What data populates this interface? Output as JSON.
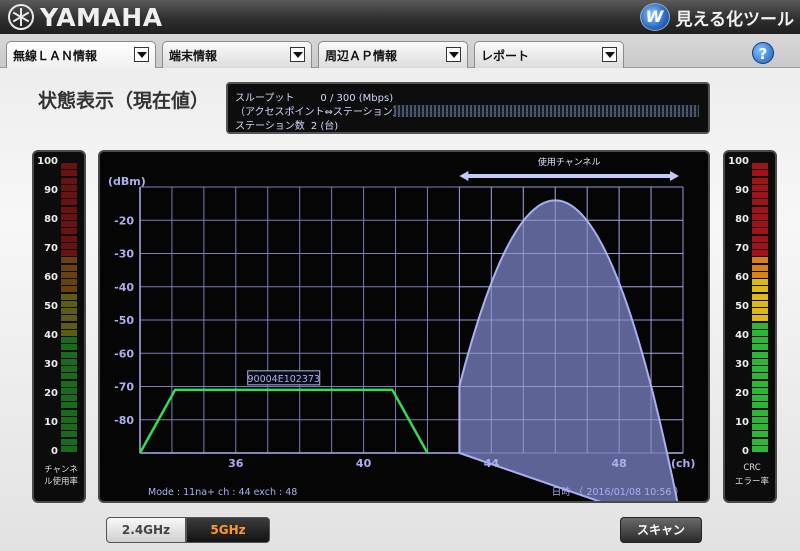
{
  "header": {
    "logo_text": "YAMAHA",
    "app_title": "見える化ツール",
    "app_icon": "W"
  },
  "tabs": [
    {
      "label": "無線ＬＡＮ情報",
      "active": true
    },
    {
      "label": "端末情報",
      "active": false
    },
    {
      "label": "周辺ＡＰ情報",
      "active": false
    },
    {
      "label": "レポート",
      "active": false
    }
  ],
  "help": {
    "label": "?"
  },
  "page_title": "状態表示（現在値）",
  "stats": {
    "throughput_label": "スループット",
    "throughput_value": "0 / 300 (Mbps)",
    "throughput_sub": "（アクセスポイント⇔ステーション）",
    "stations_label": "ステーション数",
    "stations_value": "2 (台)",
    "throughput_fraction": 0
  },
  "left_meter": {
    "ticks": [
      "100",
      "90",
      "80",
      "70",
      "60",
      "50",
      "40",
      "30",
      "20",
      "10",
      "0"
    ],
    "caption": [
      "チャンネ",
      "ル使用率"
    ],
    "level": 0
  },
  "right_meter": {
    "ticks": [
      "100",
      "90",
      "80",
      "70",
      "60",
      "50",
      "40",
      "30",
      "20",
      "10",
      "0"
    ],
    "caption": [
      "CRC",
      "エラー率"
    ],
    "level": 0
  },
  "chart_data": {
    "type": "area",
    "ylabel": "(dBm)",
    "xlabel": "(ch)",
    "ylim": [
      -90,
      -10
    ],
    "xlim": [
      33,
      50
    ],
    "y_ticks": [
      -20,
      -30,
      -40,
      -50,
      -60,
      -70,
      -80
    ],
    "x_ticks": [
      36,
      40,
      44,
      48
    ],
    "grid": true,
    "annotation": "使用チャンネル",
    "annotation_range": [
      43,
      50
    ],
    "footer_left": "Mode : 11na+    ch : 44    exch : 48",
    "footer_right": "日時 （ 2016/01/08 10:56 ）",
    "series": [
      {
        "name": "90004E102373",
        "color": "#33dd55",
        "points": [
          [
            33,
            -90
          ],
          [
            34.1,
            -71
          ],
          [
            40.9,
            -71
          ],
          [
            42,
            -90
          ]
        ]
      },
      {
        "color": "#aab0ee",
        "fill": "#6e74b0",
        "shape": "parabola",
        "x_range": [
          43,
          50
        ],
        "peak": [
          46,
          -14
        ],
        "base": -90
      }
    ]
  },
  "buttons": {
    "band_24": "2.4GHz",
    "band_5": "5GHz",
    "scan": "スキャン"
  },
  "colors": {
    "accent_band": "#ff9a2a",
    "grid": "#7a7fb8",
    "axis_text": "#aab0ee"
  }
}
